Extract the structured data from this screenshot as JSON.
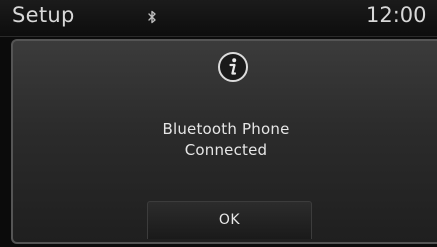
{
  "status_bar": {
    "title": "Setup",
    "clock": "12:00",
    "icons": [
      "bluetooth-icon"
    ]
  },
  "popup": {
    "icon": "info-icon",
    "message_line1": "Bluetooth Phone",
    "message_line2": "Connected",
    "ok_label": "OK"
  },
  "colors": {
    "text": "#e6e6e6",
    "background": "#0b0b0b",
    "popup_border": "#555555"
  }
}
